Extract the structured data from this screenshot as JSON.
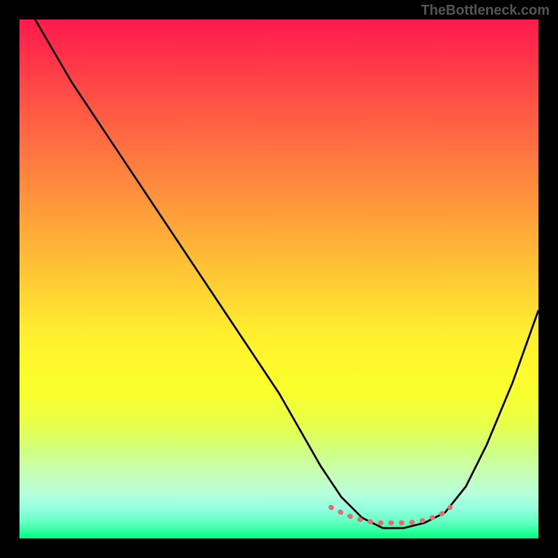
{
  "watermark": "TheBottleneck.com",
  "chart_data": {
    "type": "line",
    "title": "",
    "xlabel": "",
    "ylabel": "",
    "xlim": [
      0,
      100
    ],
    "ylim": [
      0,
      100
    ],
    "series": [
      {
        "name": "curve",
        "color": "#000000",
        "x": [
          3,
          10,
          20,
          30,
          40,
          50,
          58,
          62,
          66,
          70,
          74,
          78,
          82,
          86,
          90,
          95,
          100
        ],
        "y": [
          100,
          88,
          73,
          58,
          43,
          28,
          14,
          8,
          4,
          2,
          2,
          3,
          5,
          10,
          18,
          30,
          44
        ]
      },
      {
        "name": "highlight",
        "color": "#e07070",
        "x": [
          60,
          63,
          66,
          69,
          72,
          75,
          78,
          81,
          83
        ],
        "y": [
          6,
          4.5,
          3.5,
          3,
          3,
          3,
          3.5,
          4.5,
          6
        ]
      }
    ],
    "annotations": []
  }
}
